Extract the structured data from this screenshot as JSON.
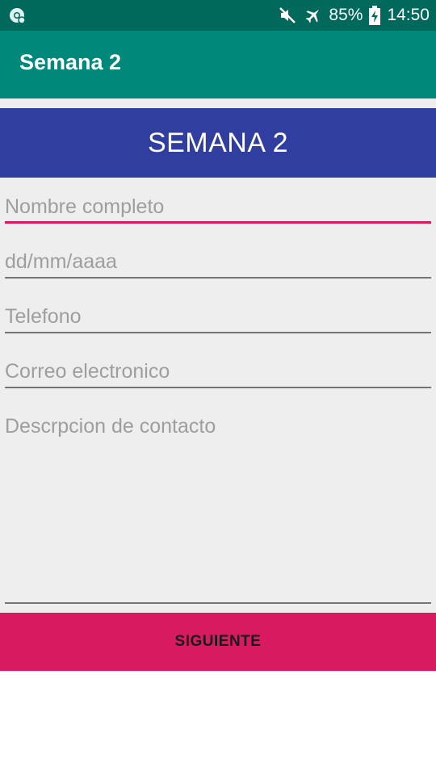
{
  "status_bar": {
    "battery": "85%",
    "time": "14:50",
    "icons": [
      "chrome-icon",
      "mute-icon",
      "airplane-icon",
      "battery-charging-icon"
    ]
  },
  "app_bar": {
    "title": "Semana 2"
  },
  "header": {
    "text": "SEMANA 2"
  },
  "form": {
    "name_placeholder": "Nombre completo",
    "name_value": "",
    "date_placeholder": "dd/mm/aaaa",
    "date_value": "",
    "phone_placeholder": "Telefono",
    "phone_value": "",
    "email_placeholder": "Correo electronico",
    "email_value": "",
    "description_placeholder": "Descrpcion de contacto",
    "description_value": ""
  },
  "next_button": {
    "label": "SIGUIENTE"
  },
  "colors": {
    "status_bar": "#00695c",
    "app_bar": "#00897b",
    "header_band": "#303f9f",
    "accent": "#d81b60",
    "background": "#eeeeee"
  }
}
